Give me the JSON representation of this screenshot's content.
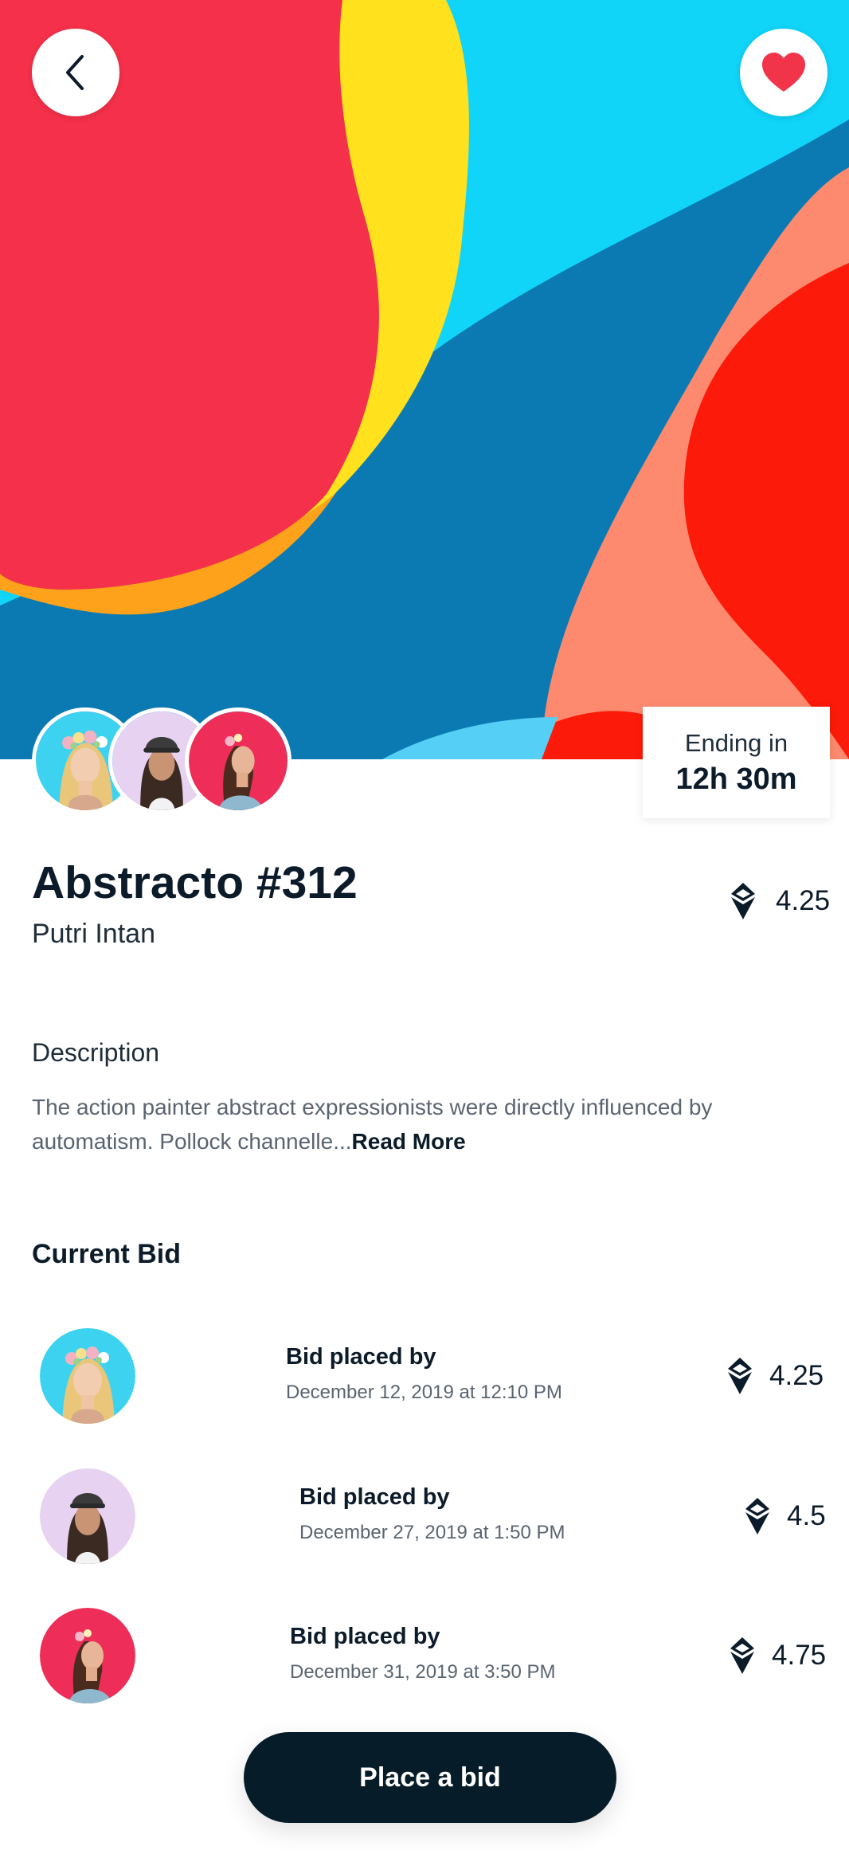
{
  "nav": {
    "back_icon": "chevron-left-icon",
    "favorite_icon": "heart-icon"
  },
  "colors": {
    "accent": "#061c28",
    "favorite": "#f2344a",
    "art_red": "#f5304a",
    "art_cyan": "#10d4f8",
    "art_yellow": "#ffe11d",
    "art_blue": "#0b7ab3",
    "art_salmon": "#fd8a6e",
    "art_orange_red": "#fc1a0a"
  },
  "auction": {
    "ending_label": "Ending in",
    "ending_value": "12h 30m"
  },
  "item": {
    "title": "Abstracto #312",
    "creator": "Putri Intan",
    "price": "4.25",
    "currency_icon": "ethereum-icon"
  },
  "description": {
    "heading": "Description",
    "text": "The action painter abstract expressionists were directly influenced by automatism. Pollock channelle...",
    "read_more": "Read More"
  },
  "bids": {
    "heading": "Current Bid",
    "items": [
      {
        "label": "Bid placed by",
        "date": "December 12, 2019 at 12:10 PM",
        "amount": "4.25"
      },
      {
        "label": "Bid placed by",
        "date": "December 27, 2019 at 1:50 PM",
        "amount": "4.5"
      },
      {
        "label": "Bid placed by",
        "date": "December 31, 2019 at 3:50 PM",
        "amount": "4.75"
      }
    ]
  },
  "cta": {
    "label": "Place a bid"
  }
}
